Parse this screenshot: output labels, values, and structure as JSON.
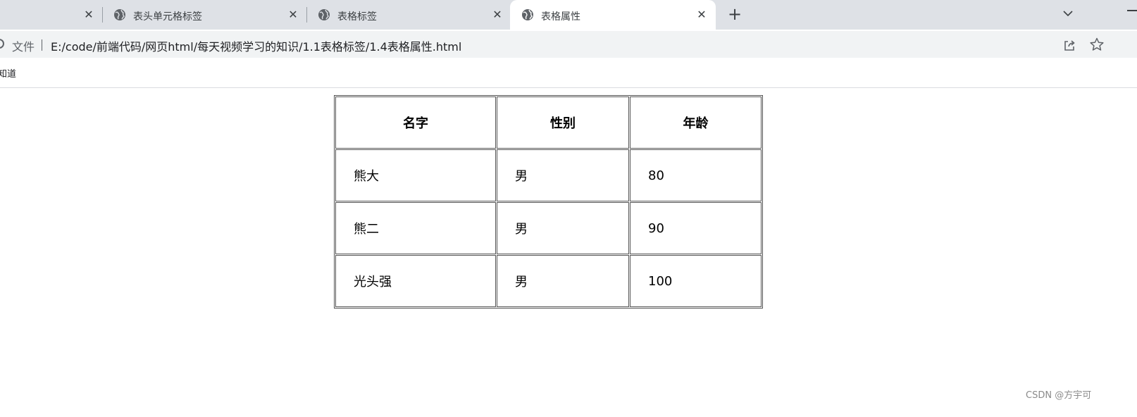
{
  "browser": {
    "tabs": [
      {
        "title": "",
        "active": false
      },
      {
        "title": "表头单元格标签",
        "active": false
      },
      {
        "title": "表格标签",
        "active": false
      },
      {
        "title": "表格属性",
        "active": true
      }
    ],
    "new_tab_symbol": "+",
    "close_symbol": "✕",
    "address": {
      "scheme_label": "文件",
      "url": "E:/code/前端代码/网页html/每天视频学习的知识/1.1表格标签/1.4表格属性.html"
    },
    "bookmarks": [
      "知道"
    ]
  },
  "table": {
    "headers": [
      "名字",
      "性别",
      "年龄"
    ],
    "rows": [
      [
        "熊大",
        "男",
        "80"
      ],
      [
        "熊二",
        "男",
        "90"
      ],
      [
        "光头强",
        "男",
        "100"
      ]
    ]
  },
  "watermark": "CSDN @方宇可",
  "icons": {
    "tab_favicon": "globe-icon",
    "tab_search": "chevron-down-icon",
    "share": "share-icon",
    "bookmark": "star-icon",
    "site_info": "info-icon"
  }
}
